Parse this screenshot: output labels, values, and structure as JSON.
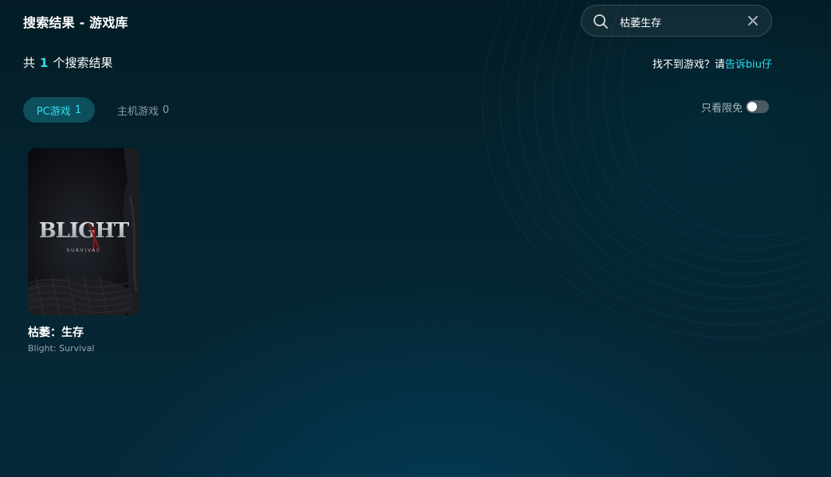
{
  "header": {
    "title": "搜索结果 - 游戏库"
  },
  "search": {
    "value": "枯萎生存",
    "icon": "search-icon",
    "clear_icon": "close-icon"
  },
  "results": {
    "prefix": "共",
    "count": "1",
    "suffix": "个搜索结果"
  },
  "help": {
    "text": "找不到游戏？请",
    "link_label": "告诉biu仔"
  },
  "tabs": [
    {
      "label": "PC游戏",
      "count": "1",
      "active": true
    },
    {
      "label": "主机游戏",
      "count": "0",
      "active": false
    }
  ],
  "filter": {
    "label": "只看限免",
    "enabled": false
  },
  "games": [
    {
      "title": "枯萎：生存",
      "subtitle": "Blight: Survival",
      "cover_logo": "BLIGHT",
      "cover_tagline": "SURVIVAL"
    }
  ],
  "colors": {
    "accent": "#2ee0f2",
    "active_tab_bg": "#0d4f5c",
    "background": "#052430"
  }
}
